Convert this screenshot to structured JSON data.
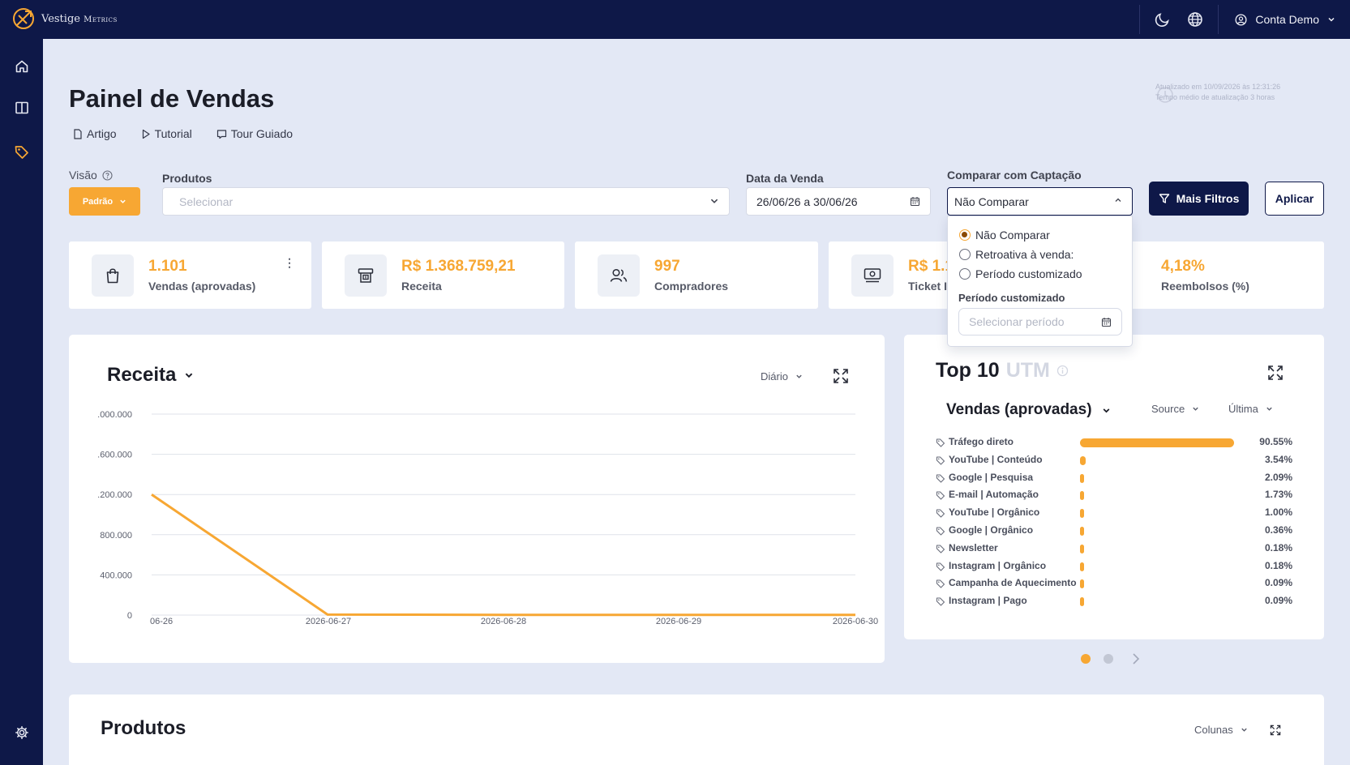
{
  "app": {
    "logo_name": "Vestige",
    "logo_sub": "Metrics",
    "brand_color": "#f7a733",
    "nav_color": "#0e1848"
  },
  "topbar": {
    "account_label": "Conta Demo",
    "icons": [
      "moon-icon",
      "globe-icon",
      "user-circle-icon"
    ]
  },
  "sidebar": {
    "items": [
      {
        "icon": "home-icon"
      },
      {
        "icon": "layout-icon"
      },
      {
        "icon": "tag-icon",
        "active": true
      },
      {
        "icon": "gear-icon"
      }
    ]
  },
  "header": {
    "title": "Painel de Vendas",
    "links": [
      {
        "label": "Artigo",
        "icon": "file-icon"
      },
      {
        "label": "Tutorial",
        "icon": "play-icon"
      },
      {
        "label": "Tour Guiado",
        "icon": "book-icon"
      }
    ],
    "updated_line1": "Atualizado em 10/09/2026 às 12:31:26",
    "updated_line2": "Tempo médio de atualização 3 horas"
  },
  "filters": {
    "visao_label": "Visão",
    "visao_value": "Padrão",
    "produtos_label": "Produtos",
    "produtos_placeholder": "Selecionar",
    "data_label": "Data da Venda",
    "data_value": "26/06/26 a 30/06/26",
    "comparar_label": "Comparar com Captação",
    "comparar_value": "Não Comparar",
    "mais_filtros": "Mais Filtros",
    "aplicar": "Aplicar"
  },
  "compare_dropdown": {
    "options": [
      {
        "label": "Não Comparar",
        "selected": true
      },
      {
        "label": "Retroativa à venda:",
        "selected": false
      },
      {
        "label": "Período customizado",
        "selected": false
      }
    ],
    "custom_label": "Período customizado",
    "custom_placeholder": "Selecionar período"
  },
  "stats": [
    {
      "value": "1.101",
      "label": "Vendas (aprovadas)",
      "icon": "shopping-bag-icon"
    },
    {
      "value": "R$ 1.368.759,21",
      "label": "Receita",
      "icon": "cash-register-icon"
    },
    {
      "value": "997",
      "label": "Compradores",
      "icon": "users-icon"
    },
    {
      "value": "R$ 1.1",
      "label": "Ticket I",
      "icon": "money-icon"
    },
    {
      "value": "4,18%",
      "label": "Reembolsos (%)",
      "icon": "refund-icon"
    }
  ],
  "revenue_panel": {
    "title": "Receita",
    "period": "Diário"
  },
  "chart_data": {
    "type": "line",
    "title": "Receita",
    "x": [
      "2026-06-26",
      "2026-06-27",
      "2026-06-28",
      "2026-06-29",
      "2026-06-30"
    ],
    "x_tick_labels": [
      "06-26",
      "2026-06-27",
      "2026-06-28",
      "2026-06-29",
      "2026-06-30"
    ],
    "series": [
      {
        "values": [
          1200000,
          5000,
          2000,
          2500,
          2000
        ],
        "color": "#f7a733"
      }
    ],
    "y_ticks": [
      0,
      400000,
      800000,
      1200000,
      1600000,
      2000000
    ],
    "y_tick_labels": [
      "0",
      "400.000",
      "800.000",
      ".200.000",
      ".600.000",
      ".000.000"
    ],
    "ylim": [
      0,
      2000000
    ],
    "grid": true
  },
  "utm_panel": {
    "title": "Top 10",
    "title_ghost": "UTM",
    "metric": "Vendas (aprovadas)",
    "source_label": "Source",
    "touch_label": "Última",
    "rows": [
      {
        "name": "Tráfego direto",
        "pct_text": "90.55%",
        "pct": 90.55
      },
      {
        "name": "YouTube | Conteúdo",
        "pct_text": "3.54%",
        "pct": 3.54
      },
      {
        "name": "Google | Pesquisa",
        "pct_text": "2.09%",
        "pct": 2.09
      },
      {
        "name": "E-mail | Automação",
        "pct_text": "1.73%",
        "pct": 1.73
      },
      {
        "name": "YouTube | Orgânico",
        "pct_text": "1.00%",
        "pct": 1.0
      },
      {
        "name": "Google | Orgânico",
        "pct_text": "0.36%",
        "pct": 0.36
      },
      {
        "name": "Newsletter",
        "pct_text": "0.18%",
        "pct": 0.18
      },
      {
        "name": "Instagram | Orgânico",
        "pct_text": "0.18%",
        "pct": 0.18
      },
      {
        "name": "Campanha de Aquecimento",
        "pct_text": "0.09%",
        "pct": 0.09
      },
      {
        "name": "Instagram | Pago",
        "pct_text": "0.09%",
        "pct": 0.09
      }
    ],
    "page_current": 1,
    "page_count": 2
  },
  "produtos_panel": {
    "title": "Produtos",
    "columns_label": "Colunas"
  }
}
